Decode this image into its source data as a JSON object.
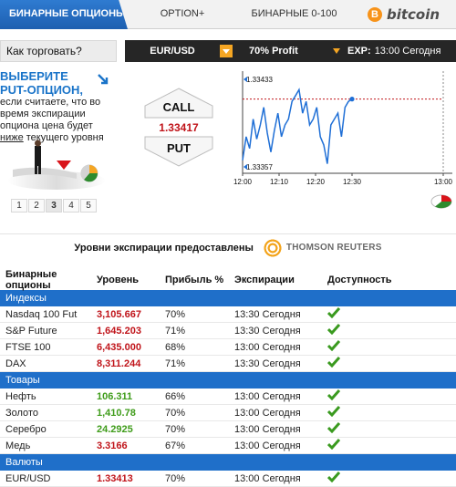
{
  "tabs": [
    {
      "label": "БИНАРНЫЕ ОПЦИОНЫ"
    },
    {
      "label": "OPTION+"
    },
    {
      "label": "БИНАРНЫЕ 0-100"
    },
    {
      "label": "bitcoin"
    }
  ],
  "bitcoin_symbol": "B",
  "howto_label": "Как торговать?",
  "controls": {
    "asset": "EUR/USD",
    "profit": "70% Profit",
    "exp_label": "EXP:",
    "exp_value": "13:00 Сегодня"
  },
  "instruction": {
    "line1": "ВЫБЕРИТЕ",
    "line2_strong": "PUT",
    "line2_rest": "-ОПЦИОН,",
    "line3": "если считаете, что во время экспирации опциона цена будет",
    "underline_word": "ниже",
    "line4_rest": "текущего уровня"
  },
  "steps": [
    "1",
    "2",
    "3",
    "4",
    "5"
  ],
  "current_step": "3",
  "call_label": "CALL",
  "put_label": "PUT",
  "current_price": "1.33417",
  "chart_data": {
    "type": "line",
    "x": [
      "12:00",
      "12:01",
      "12:02",
      "12:03",
      "12:04",
      "12:05",
      "12:06",
      "12:07",
      "12:08",
      "12:09",
      "12:10",
      "12:11",
      "12:12",
      "12:13",
      "12:14",
      "12:15",
      "12:16",
      "12:17",
      "12:18",
      "12:19",
      "12:20",
      "12:21",
      "12:22",
      "12:23",
      "12:24",
      "12:25",
      "12:26",
      "12:27",
      "12:28",
      "12:29",
      "12:30",
      "12:31"
    ],
    "series": [
      {
        "values": [
          1.33365,
          1.33385,
          1.33375,
          1.334,
          1.33383,
          1.33395,
          1.3341,
          1.33388,
          1.33372,
          1.3339,
          1.33405,
          1.33385,
          1.33395,
          1.334,
          1.33415,
          1.3342,
          1.33425,
          1.33405,
          1.33415,
          1.33395,
          1.334,
          1.3341,
          1.33385,
          1.33378,
          1.33362,
          1.33395,
          1.334,
          1.33405,
          1.33385,
          1.3341,
          1.33415,
          1.33417
        ]
      }
    ],
    "y_labels": [
      "1.33433",
      "1.33357"
    ],
    "ylim": [
      1.33357,
      1.33433
    ],
    "x_ticks": [
      "12:00",
      "12:10",
      "12:20",
      "12:30",
      "13:00"
    ],
    "expiry_marker": "13:00"
  },
  "reuters": {
    "text": "Уровни экспирации предоставлены",
    "brand": "THOMSON REUTERS"
  },
  "table": {
    "headers": {
      "col1_line1": "Бинарные",
      "col1_line2": "опционы",
      "col2": "Уровень",
      "col3": "Прибыль %",
      "col4": "Экспирации",
      "col5": "Доступность"
    },
    "groups": [
      {
        "name": "Индексы",
        "rows": [
          {
            "asset": "Nasdaq 100 Fut",
            "level": "3,105.667",
            "profit": "70%",
            "expiry": "13:30 Сегодня"
          },
          {
            "asset": "S&P Future",
            "level": "1,645.203",
            "profit": "71%",
            "expiry": "13:30 Сегодня"
          },
          {
            "asset": "FTSE 100",
            "level": "6,435.000",
            "profit": "68%",
            "expiry": "13:00 Сегодня"
          },
          {
            "asset": "DAX",
            "level": "8,311.244",
            "profit": "71%",
            "expiry": "13:30 Сегодня"
          }
        ]
      },
      {
        "name": "Товары",
        "rows": [
          {
            "asset": "Нефть",
            "level": "106.311",
            "profit": "66%",
            "expiry": "13:00 Сегодня"
          },
          {
            "asset": "Золото",
            "level": "1,410.78",
            "profit": "70%",
            "expiry": "13:00 Сегодня"
          },
          {
            "asset": "Серебро",
            "level": "24.2925",
            "profit": "70%",
            "expiry": "13:00 Сегодня"
          },
          {
            "asset": "Медь",
            "level": "3.3166",
            "profit": "67%",
            "expiry": "13:00 Сегодня"
          }
        ]
      },
      {
        "name": "Валюты",
        "rows": [
          {
            "asset": "EUR/USD",
            "level": "1.33413",
            "profit": "70%",
            "expiry": "13:00 Сегодня"
          }
        ]
      }
    ]
  },
  "colors": {
    "accent": "#1f6fc9",
    "orange": "#f5a623",
    "level_red": "#c0141a",
    "level_green": "#3f9c1a",
    "check_green": "#3a9a1f"
  }
}
